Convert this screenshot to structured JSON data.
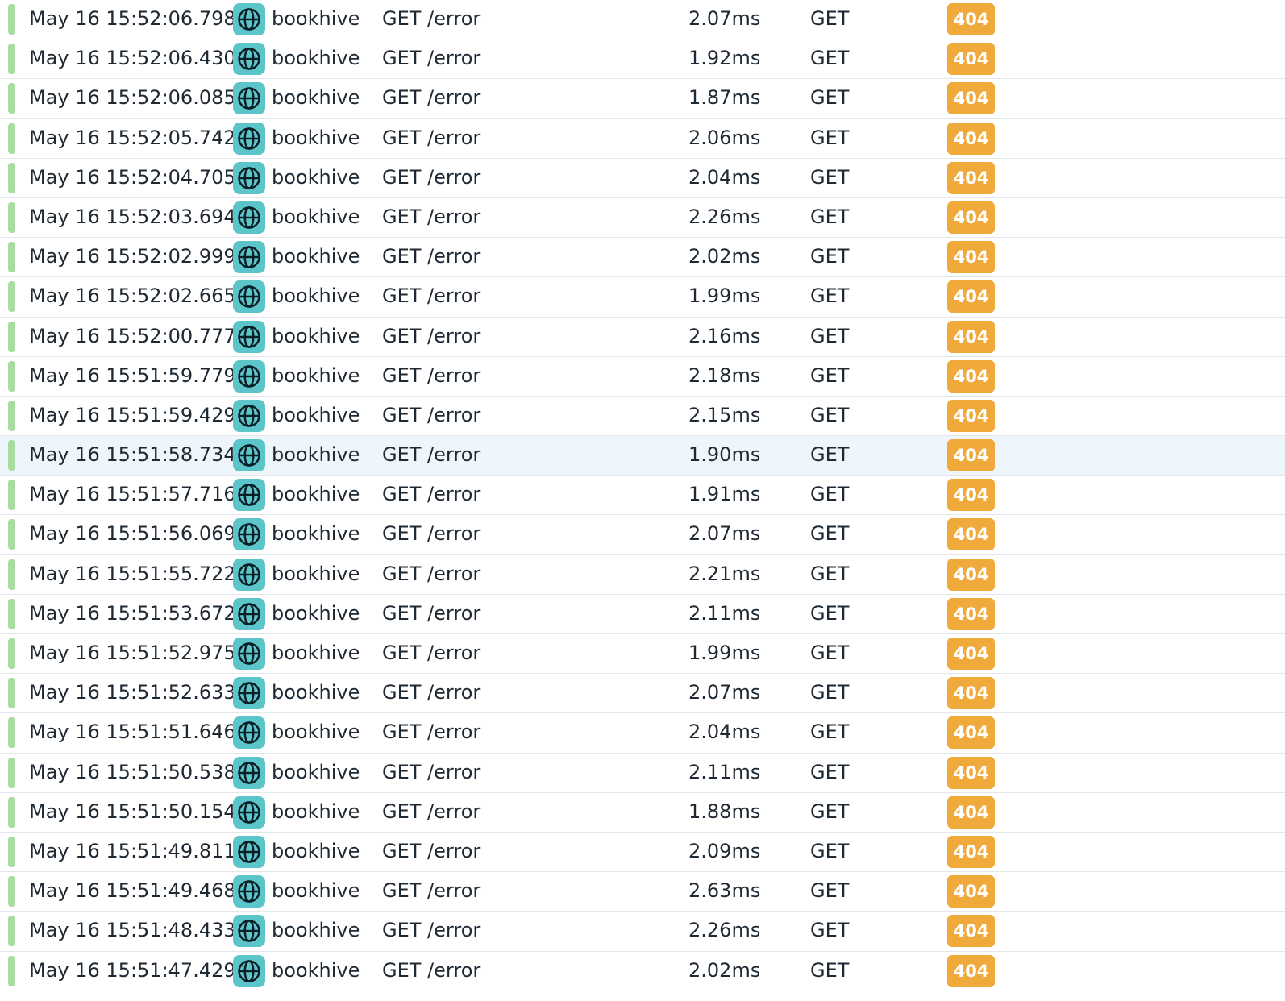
{
  "colors": {
    "status_bar": "#a8dca0",
    "service_icon_bg": "#5cc5c9",
    "status_badge_bg": "#f0a93b",
    "highlight_row_bg": "#eef6fb"
  },
  "icons": {
    "service": "globe-icon"
  },
  "highlighted_row": 11,
  "rows": [
    {
      "time": "May 16 15:52:06.798",
      "service": "bookhive",
      "resource": "GET /error",
      "duration": "2.07ms",
      "method": "GET",
      "status": "404"
    },
    {
      "time": "May 16 15:52:06.430",
      "service": "bookhive",
      "resource": "GET /error",
      "duration": "1.92ms",
      "method": "GET",
      "status": "404"
    },
    {
      "time": "May 16 15:52:06.085",
      "service": "bookhive",
      "resource": "GET /error",
      "duration": "1.87ms",
      "method": "GET",
      "status": "404"
    },
    {
      "time": "May 16 15:52:05.742",
      "service": "bookhive",
      "resource": "GET /error",
      "duration": "2.06ms",
      "method": "GET",
      "status": "404"
    },
    {
      "time": "May 16 15:52:04.705",
      "service": "bookhive",
      "resource": "GET /error",
      "duration": "2.04ms",
      "method": "GET",
      "status": "404"
    },
    {
      "time": "May 16 15:52:03.694",
      "service": "bookhive",
      "resource": "GET /error",
      "duration": "2.26ms",
      "method": "GET",
      "status": "404"
    },
    {
      "time": "May 16 15:52:02.999",
      "service": "bookhive",
      "resource": "GET /error",
      "duration": "2.02ms",
      "method": "GET",
      "status": "404"
    },
    {
      "time": "May 16 15:52:02.665",
      "service": "bookhive",
      "resource": "GET /error",
      "duration": "1.99ms",
      "method": "GET",
      "status": "404"
    },
    {
      "time": "May 16 15:52:00.777",
      "service": "bookhive",
      "resource": "GET /error",
      "duration": "2.16ms",
      "method": "GET",
      "status": "404"
    },
    {
      "time": "May 16 15:51:59.779",
      "service": "bookhive",
      "resource": "GET /error",
      "duration": "2.18ms",
      "method": "GET",
      "status": "404"
    },
    {
      "time": "May 16 15:51:59.429",
      "service": "bookhive",
      "resource": "GET /error",
      "duration": "2.15ms",
      "method": "GET",
      "status": "404"
    },
    {
      "time": "May 16 15:51:58.734",
      "service": "bookhive",
      "resource": "GET /error",
      "duration": "1.90ms",
      "method": "GET",
      "status": "404"
    },
    {
      "time": "May 16 15:51:57.716",
      "service": "bookhive",
      "resource": "GET /error",
      "duration": "1.91ms",
      "method": "GET",
      "status": "404"
    },
    {
      "time": "May 16 15:51:56.069",
      "service": "bookhive",
      "resource": "GET /error",
      "duration": "2.07ms",
      "method": "GET",
      "status": "404"
    },
    {
      "time": "May 16 15:51:55.722",
      "service": "bookhive",
      "resource": "GET /error",
      "duration": "2.21ms",
      "method": "GET",
      "status": "404"
    },
    {
      "time": "May 16 15:51:53.672",
      "service": "bookhive",
      "resource": "GET /error",
      "duration": "2.11ms",
      "method": "GET",
      "status": "404"
    },
    {
      "time": "May 16 15:51:52.975",
      "service": "bookhive",
      "resource": "GET /error",
      "duration": "1.99ms",
      "method": "GET",
      "status": "404"
    },
    {
      "time": "May 16 15:51:52.633",
      "service": "bookhive",
      "resource": "GET /error",
      "duration": "2.07ms",
      "method": "GET",
      "status": "404"
    },
    {
      "time": "May 16 15:51:51.646",
      "service": "bookhive",
      "resource": "GET /error",
      "duration": "2.04ms",
      "method": "GET",
      "status": "404"
    },
    {
      "time": "May 16 15:51:50.538",
      "service": "bookhive",
      "resource": "GET /error",
      "duration": "2.11ms",
      "method": "GET",
      "status": "404"
    },
    {
      "time": "May 16 15:51:50.154",
      "service": "bookhive",
      "resource": "GET /error",
      "duration": "1.88ms",
      "method": "GET",
      "status": "404"
    },
    {
      "time": "May 16 15:51:49.811",
      "service": "bookhive",
      "resource": "GET /error",
      "duration": "2.09ms",
      "method": "GET",
      "status": "404"
    },
    {
      "time": "May 16 15:51:49.468",
      "service": "bookhive",
      "resource": "GET /error",
      "duration": "2.63ms",
      "method": "GET",
      "status": "404"
    },
    {
      "time": "May 16 15:51:48.433",
      "service": "bookhive",
      "resource": "GET /error",
      "duration": "2.26ms",
      "method": "GET",
      "status": "404"
    },
    {
      "time": "May 16 15:51:47.429",
      "service": "bookhive",
      "resource": "GET /error",
      "duration": "2.02ms",
      "method": "GET",
      "status": "404"
    }
  ]
}
